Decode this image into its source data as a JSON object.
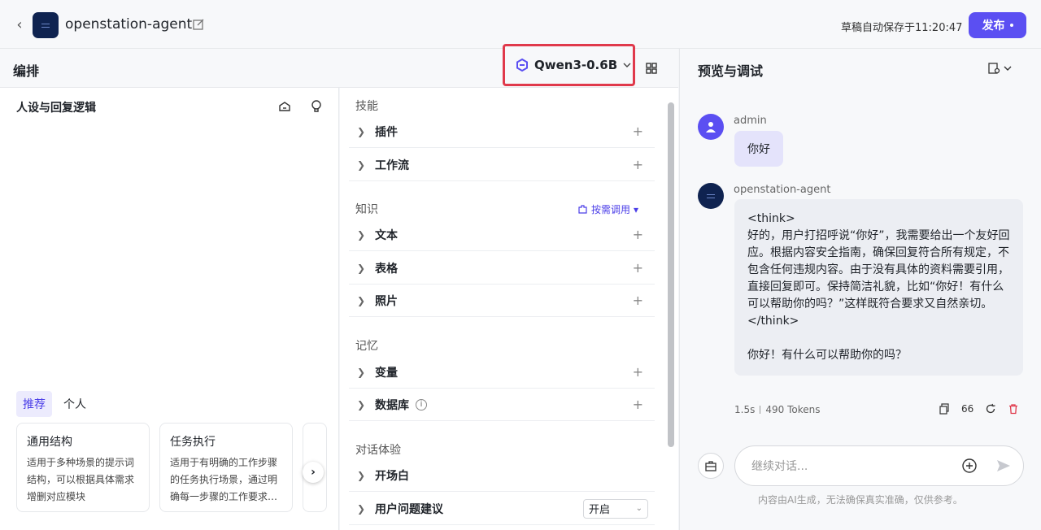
{
  "header": {
    "app_name": "openstation-agent",
    "save_note": "草稿自动保存于11:20:47",
    "publish_label": "发布"
  },
  "edit": {
    "title": "编排",
    "model": "Qwen3-0.6B"
  },
  "persona": {
    "title": "人设与回复逻辑",
    "tabs": [
      "推荐",
      "个人"
    ],
    "cards": [
      {
        "title": "通用结构",
        "desc": "适用于多种场景的提示词结构，可以根据具体需求增删对应模块"
      },
      {
        "title": "任务执行",
        "desc": "适用于有明确的工作步骤的任务执行场景，通过明确每一步骤的工作要求…"
      }
    ]
  },
  "skills": {
    "sections": [
      {
        "title": "技能",
        "rows": [
          "插件",
          "工作流"
        ]
      },
      {
        "title": "知识",
        "extra": "按需调用",
        "rows": [
          "文本",
          "表格",
          "照片"
        ]
      },
      {
        "title": "记忆",
        "rows": [
          "变量",
          "数据库"
        ]
      },
      {
        "title": "对话体验",
        "rows": [
          "开场白",
          "用户问题建议"
        ]
      }
    ],
    "suggest_value": "开启"
  },
  "preview": {
    "title": "预览与调试",
    "user_name": "admin",
    "user_msg": "你好",
    "bot_name": "openstation-agent",
    "bot_msg": "<think>\n好的，用户打招呼说“你好”，我需要给出一个友好回应。根据内容安全指南，确保回复符合所有规定，不包含任何违规内容。由于没有具体的资料需要引用，直接回复即可。保持简洁礼貌，比如“你好！有什么可以帮助你的吗？”这样既符合要求又自然亲切。\n</think>\n\n你好！有什么可以帮助你的吗？",
    "time": "1.5s",
    "tokens": "490 Tokens",
    "quote_count": "66",
    "input_placeholder": "继续对话...",
    "disclaimer": "内容由AI生成，无法确保真实准确，仅供参考。"
  },
  "colors": {
    "accent": "#5b4ff2",
    "highlight_border": "#e0394b"
  }
}
